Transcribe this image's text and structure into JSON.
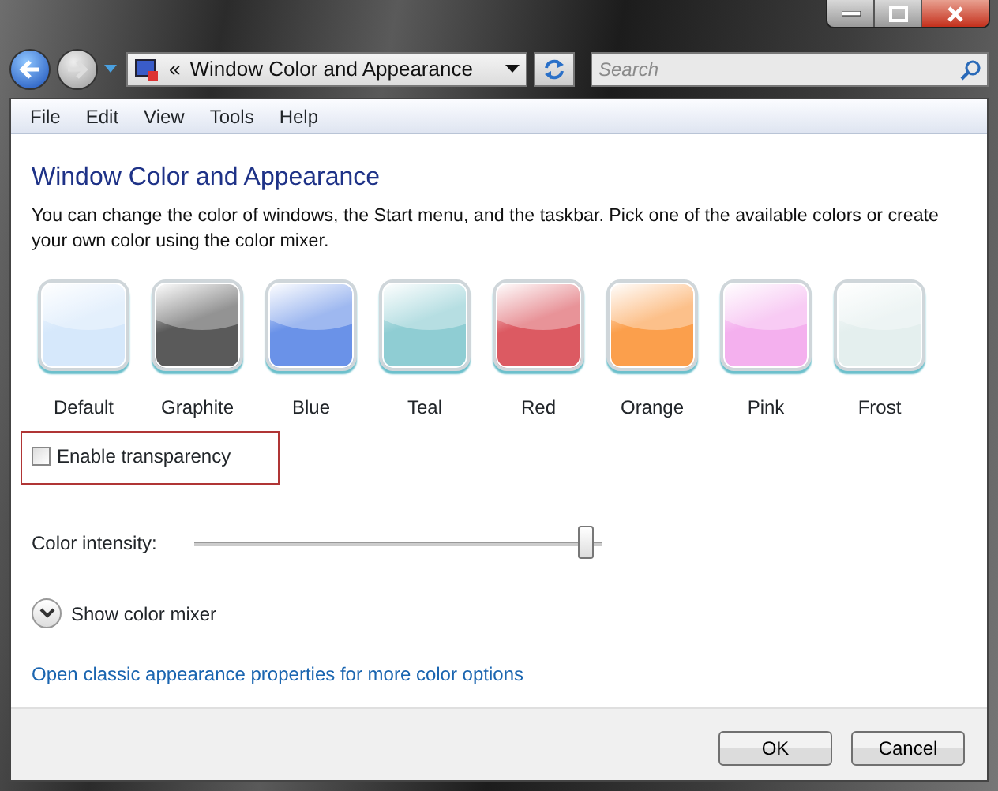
{
  "address_bar": {
    "separator": "«",
    "location": "Window Color and Appearance"
  },
  "search": {
    "placeholder": "Search"
  },
  "menu": [
    "File",
    "Edit",
    "View",
    "Tools",
    "Help"
  ],
  "heading": "Window Color and Appearance",
  "description": "You can change the color of windows, the Start menu, and the taskbar. Pick one of the available colors or create your own color using the color mixer.",
  "swatches": [
    {
      "label": "Default",
      "color": "#d6e8fb"
    },
    {
      "label": "Graphite",
      "color": "#5a5a5a"
    },
    {
      "label": "Blue",
      "color": "#6a92e8"
    },
    {
      "label": "Teal",
      "color": "#8fcdd3"
    },
    {
      "label": "Red",
      "color": "#dc5a62"
    },
    {
      "label": "Orange",
      "color": "#fb9f4c"
    },
    {
      "label": "Pink",
      "color": "#f4b0ee"
    },
    {
      "label": "Frost",
      "color": "#e4efee"
    }
  ],
  "transparency": {
    "label": "Enable transparency",
    "checked": false,
    "highlighted": true
  },
  "intensity": {
    "label": "Color intensity:",
    "level": 0.98
  },
  "mixer": {
    "label": "Show color mixer",
    "expanded": false
  },
  "link": "Open classic appearance properties for more color options",
  "buttons": [
    "OK",
    "Cancel"
  ]
}
